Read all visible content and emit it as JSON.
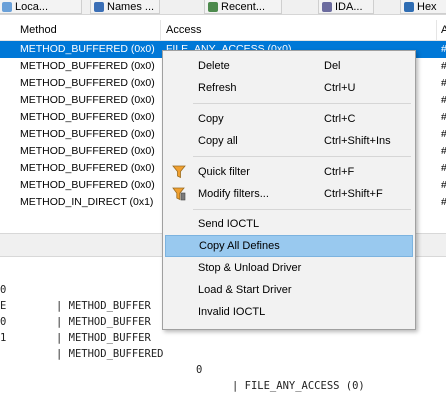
{
  "tabs": [
    {
      "label": "Loca...",
      "icon": "locals-icon"
    },
    {
      "label": "Names ...",
      "icon": "names-icon"
    },
    {
      "label": "Recent...",
      "icon": "recent-icon"
    },
    {
      "label": "IDA...",
      "icon": "ida-icon"
    },
    {
      "label": "Hex",
      "icon": "hex-icon"
    }
  ],
  "columns": {
    "method": "Method",
    "access": "Access",
    "third": "A"
  },
  "rows": [
    {
      "method": "METHOD_BUFFERED (0x0)",
      "access": "FILE_ANY_ACCESS (0x0)",
      "extra": "#",
      "selected": true
    },
    {
      "method": "METHOD_BUFFERED (0x0)",
      "extra": "#"
    },
    {
      "method": "METHOD_BUFFERED (0x0)",
      "extra": "#"
    },
    {
      "method": "METHOD_BUFFERED (0x0)",
      "extra": "#"
    },
    {
      "method": "METHOD_BUFFERED (0x0)",
      "extra": "#"
    },
    {
      "method": "METHOD_BUFFERED (0x0)",
      "extra": "#"
    },
    {
      "method": "METHOD_BUFFERED (0x0)",
      "extra": "#"
    },
    {
      "method": "METHOD_BUFFERED (0x0)",
      "extra": "#"
    },
    {
      "method": "METHOD_BUFFERED (0x0)",
      "extra": "#"
    },
    {
      "method": "METHOD_IN_DIRECT (0x1)",
      "extra": "#"
    }
  ],
  "code_lines": [
    {
      "a": "0",
      "b": "| METHOD_BUFFER",
      "c": "",
      "d": ""
    },
    {
      "a": "E",
      "b": "| METHOD_BUFFER",
      "c": "",
      "d": ""
    },
    {
      "a": "0",
      "b": "| METHOD_BUFFER",
      "c": "",
      "d": ""
    },
    {
      "a": "1",
      "b": "| METHOD_BUFFERED",
      "c": "0",
      "d": "| FILE_ANY_ACCESS (0)"
    }
  ],
  "menu": [
    {
      "label": "Delete",
      "shortcut": "Del"
    },
    {
      "label": "Refresh",
      "shortcut": "Ctrl+U"
    },
    {
      "separator": true
    },
    {
      "label": "Copy",
      "shortcut": "Ctrl+C"
    },
    {
      "label": "Copy all",
      "shortcut": "Ctrl+Shift+Ins"
    },
    {
      "separator": true
    },
    {
      "label": "Quick filter",
      "shortcut": "Ctrl+F",
      "icon": "funnel-icon"
    },
    {
      "label": "Modify filters...",
      "shortcut": "Ctrl+Shift+F",
      "icon": "funnel-edit-icon"
    },
    {
      "separator": true
    },
    {
      "label": "Send IOCTL",
      "shortcut": ""
    },
    {
      "label": "Copy All Defines",
      "shortcut": "",
      "highlighted": true
    },
    {
      "label": "Stop & Unload Driver",
      "shortcut": ""
    },
    {
      "label": "Load & Start Driver",
      "shortcut": ""
    },
    {
      "label": "Invalid IOCTL",
      "shortcut": ""
    }
  ],
  "colors": {
    "selection": "#0078d7",
    "menu_highlight": "#99c9ef",
    "menu_bg": "#f2f2f2",
    "pane_gray": "#f0f0f0"
  }
}
